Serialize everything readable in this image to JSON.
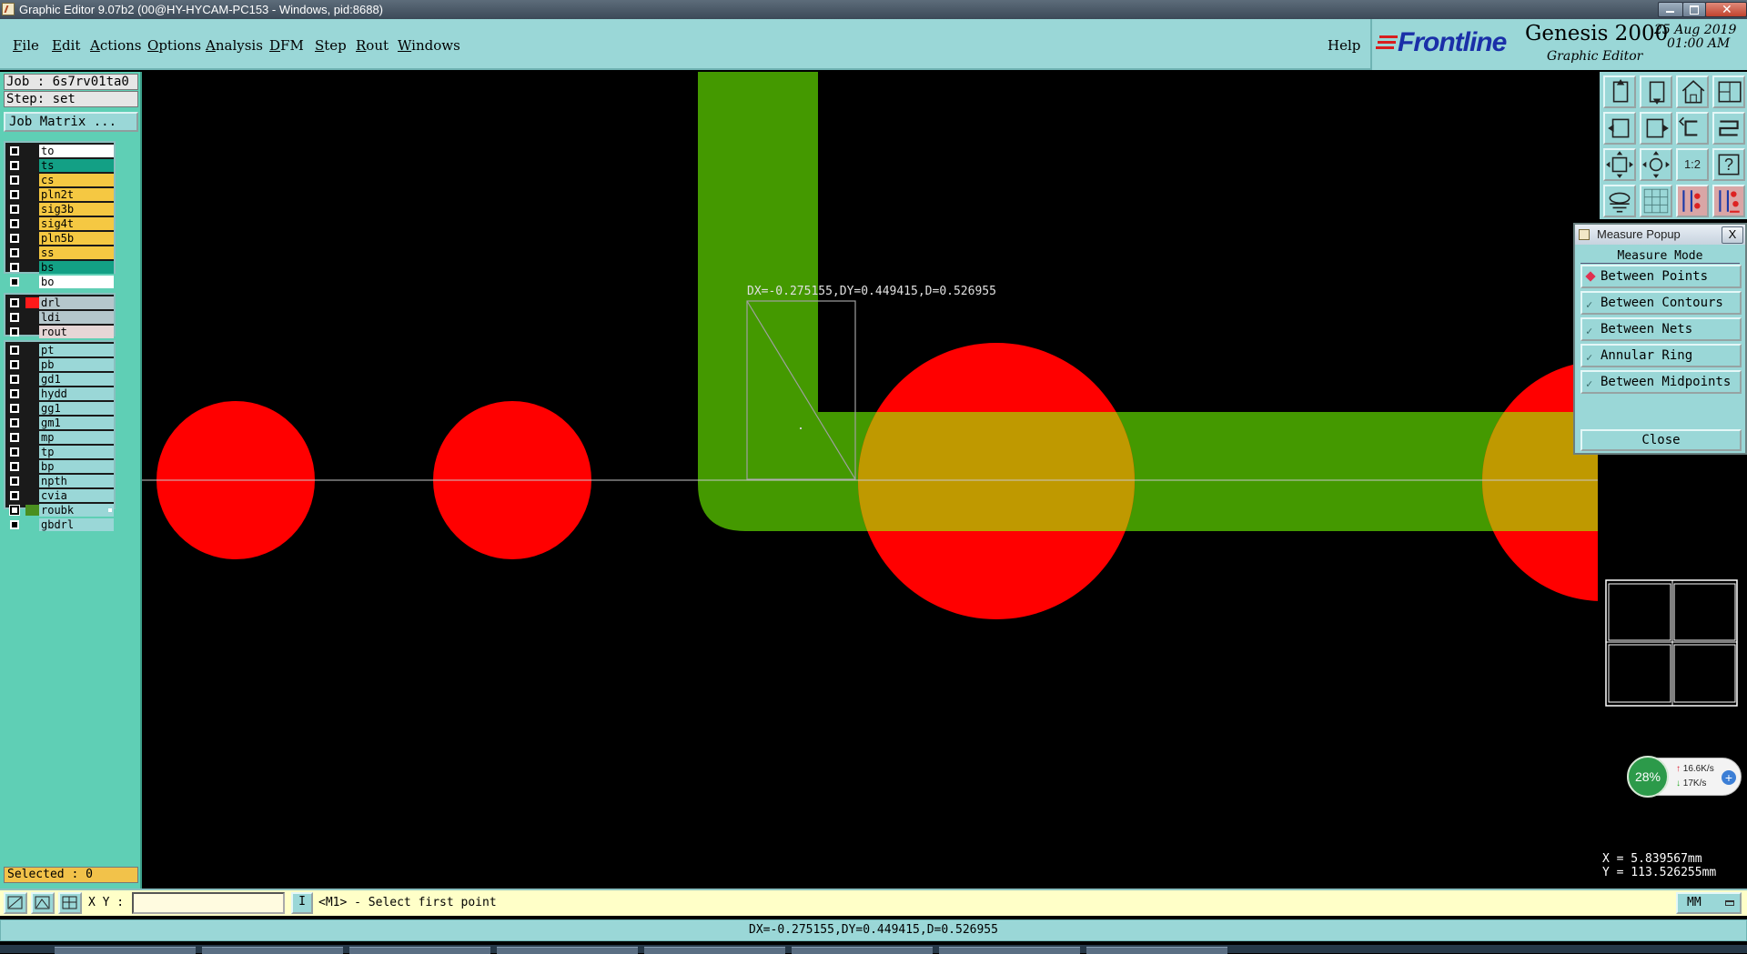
{
  "window": {
    "title": "Graphic Editor 9.07b2 (00@HY-HYCAM-PC153 - Windows, pid:8688)"
  },
  "menu": {
    "items": [
      {
        "label": "File",
        "u": "F",
        "rest": "ile"
      },
      {
        "label": "Edit",
        "u": "E",
        "rest": "dit"
      },
      {
        "label": "Actions",
        "u": "A",
        "rest": "ctions"
      },
      {
        "label": "Options",
        "u": "O",
        "rest": "ptions"
      },
      {
        "label": "Analysis",
        "u": "A",
        "rest": "nalysis"
      },
      {
        "label": "DFM",
        "u": "D",
        "rest": "FM"
      },
      {
        "label": "Step",
        "u": "S",
        "rest": "tep"
      },
      {
        "label": "Rout",
        "u": "R",
        "rest": "out"
      },
      {
        "label": "Windows",
        "u": "W",
        "rest": "indows"
      }
    ],
    "help": "Help"
  },
  "branding": {
    "logo": "Frontline",
    "product": "Genesis 2000",
    "subtitle": "Graphic Editor",
    "date": "25 Aug 2019",
    "time": "01:00 AM"
  },
  "job": {
    "job_label": "Job : 6s7rv01ta0",
    "step_label": "Step: set",
    "matrix_button": "Job Matrix ..."
  },
  "layers": {
    "group1": [
      {
        "name": "to",
        "color": "#ffffff"
      },
      {
        "name": "ts",
        "color": "#13a085"
      },
      {
        "name": "cs",
        "color": "#f5c842"
      },
      {
        "name": "pln2t",
        "color": "#f5c842"
      },
      {
        "name": "sig3b",
        "color": "#f5c842"
      },
      {
        "name": "sig4t",
        "color": "#f5c842"
      },
      {
        "name": "pln5b",
        "color": "#f5c842"
      },
      {
        "name": "ss",
        "color": "#f5c842"
      },
      {
        "name": "bs",
        "color": "#13a085"
      },
      {
        "name": "bo",
        "color": "#ffffff"
      }
    ],
    "group2": [
      {
        "name": "drl",
        "color": "#b5c7cc",
        "swatch": "#ff1a1a"
      },
      {
        "name": "ldi",
        "color": "#b5c7cc"
      },
      {
        "name": "rout",
        "color": "#e6d6d6"
      }
    ],
    "group3": [
      {
        "name": "pt",
        "color": "#9ad7d7"
      },
      {
        "name": "pb",
        "color": "#9ad7d7"
      },
      {
        "name": "gd1",
        "color": "#9ad7d7"
      },
      {
        "name": "hydd",
        "color": "#9ad7d7"
      },
      {
        "name": "gg1",
        "color": "#9ad7d7"
      },
      {
        "name": "gm1",
        "color": "#9ad7d7"
      },
      {
        "name": "mp",
        "color": "#9ad7d7"
      },
      {
        "name": "tp",
        "color": "#9ad7d7"
      },
      {
        "name": "bp",
        "color": "#9ad7d7"
      },
      {
        "name": "npth",
        "color": "#9ad7d7"
      },
      {
        "name": "cvia",
        "color": "#9ad7d7"
      },
      {
        "name": "roubk",
        "color": "#9ad7d7",
        "swatch": "#4a8f1f",
        "active": true
      },
      {
        "name": "gbdrl",
        "color": "#9ad7d7"
      }
    ],
    "selected": "Selected : 0"
  },
  "canvas": {
    "measure_text": "DX=-0.275155,DY=0.449415,D=0.526955",
    "colors": {
      "pad": "#ff0000",
      "trace": "#449900",
      "overlap": "#bf9900",
      "background": "#000000"
    }
  },
  "toolbar_icons": [
    "view-up-icon",
    "view-down-icon",
    "home-icon",
    "panes-icon",
    "pan-left-icon",
    "pan-right-icon",
    "undo-view-icon",
    "redo-view-icon",
    "zoom-fit-icon",
    "zoom-center-icon",
    "ratio-icon",
    "help-icon",
    "snap-icon",
    "grid-icon",
    "layers-toggle-icon",
    "layers-multi-icon"
  ],
  "toolbar_ratio": "1:2",
  "toolbar_help": "?",
  "measure_popup": {
    "title": "Measure Popup",
    "close_x": "X",
    "mode_label": "Measure Mode",
    "options": [
      {
        "label": "Between Points",
        "selected": true
      },
      {
        "label": "Between Contours",
        "selected": false
      },
      {
        "label": "Between Nets",
        "selected": false
      },
      {
        "label": "Annular Ring",
        "selected": false
      },
      {
        "label": "Between Midpoints",
        "selected": false
      }
    ],
    "close_button": "Close"
  },
  "speed_widget": {
    "percent": "28%",
    "up": "16.6K/s",
    "down": "17K/s",
    "plus": "+"
  },
  "coords": {
    "x": "X  =  5.839567mm",
    "y": "Y  = 113.526255mm"
  },
  "bottom": {
    "xy_label": "X Y :",
    "xy_value": "",
    "cmd_glyph": "I",
    "prompt": "<M1> - Select first point",
    "unit": "MM"
  },
  "status_line": "DX=-0.275155,DY=0.449415,D=0.526955"
}
